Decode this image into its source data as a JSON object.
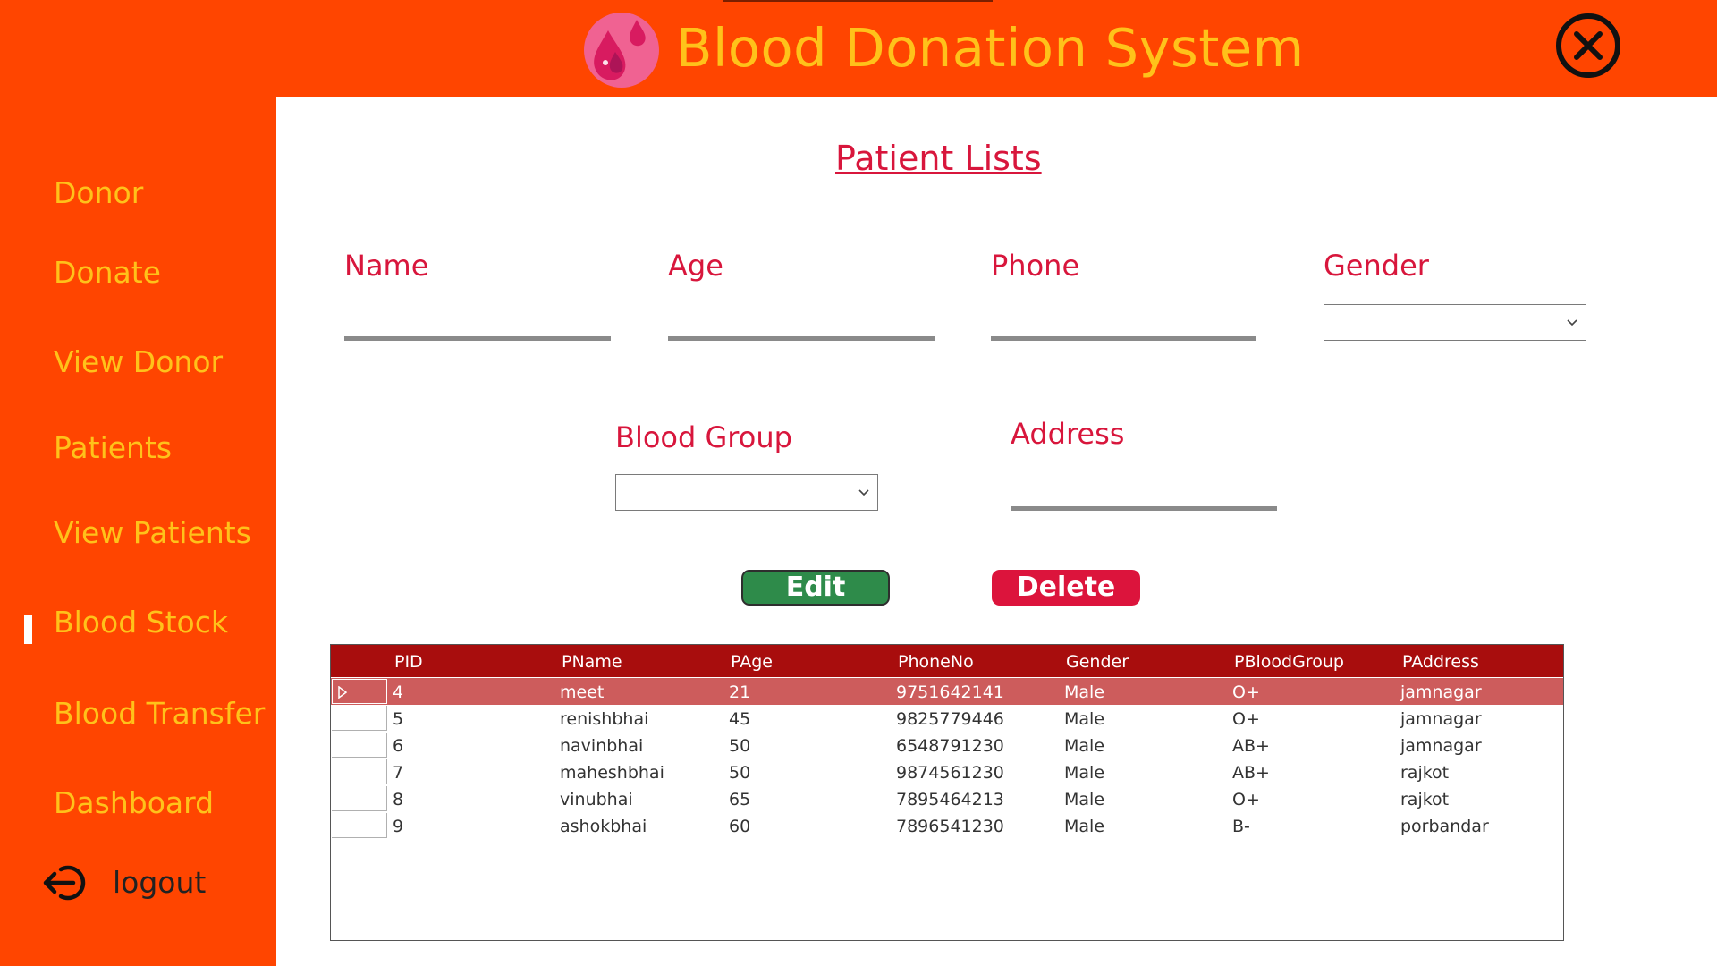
{
  "app": {
    "title": "Blood Donation System",
    "accent_color": "#ff4500",
    "title_color": "#ffc21a",
    "logo_icon": "blood-drop-logo",
    "close_icon": "close-circle-icon"
  },
  "sidebar": {
    "items": [
      {
        "label": "Donor",
        "active": false
      },
      {
        "label": "Donate",
        "active": false
      },
      {
        "label": "View Donor",
        "active": false
      },
      {
        "label": "Patients",
        "active": false
      },
      {
        "label": "View Patients",
        "active": true
      },
      {
        "label": "Blood Stock",
        "active": false
      },
      {
        "label": "Blood Transfer",
        "active": false
      },
      {
        "label": "Dashboard",
        "active": false
      }
    ],
    "logout_label": "logout",
    "logout_icon": "logout-icon"
  },
  "main": {
    "title": "Patient Lists",
    "fields": {
      "name": {
        "label": "Name",
        "value": ""
      },
      "age": {
        "label": "Age",
        "value": ""
      },
      "phone": {
        "label": "Phone",
        "value": ""
      },
      "gender": {
        "label": "Gender",
        "value": ""
      },
      "blood_group": {
        "label": "Blood Group",
        "value": ""
      },
      "address": {
        "label": "Address",
        "value": ""
      }
    },
    "buttons": {
      "edit": "Edit",
      "delete": "Delete",
      "edit_color": "#2e8b4a",
      "delete_color": "#dc143c"
    }
  },
  "grid": {
    "header_color": "#a80d0d",
    "selected_color": "#cd5c5c",
    "columns": [
      "PID",
      "PName",
      "PAge",
      "PhoneNo",
      "Gender",
      "PBloodGroup",
      "PAddress"
    ],
    "rows": [
      [
        "4",
        "meet",
        "21",
        "9751642141",
        "Male",
        "O+",
        "jamnagar"
      ],
      [
        "5",
        "renishbhai",
        "45",
        "9825779446",
        "Male",
        "O+",
        "jamnagar"
      ],
      [
        "6",
        "navinbhai",
        "50",
        "6548791230",
        "Male",
        "AB+",
        "jamnagar"
      ],
      [
        "7",
        "maheshbhai",
        "50",
        "9874561230",
        "Male",
        "AB+",
        "rajkot"
      ],
      [
        "8",
        "vinubhai",
        "65",
        "7895464213",
        "Male",
        "O+",
        "rajkot"
      ],
      [
        "9",
        "ashokbhai",
        "60",
        "7896541230",
        "Male",
        "B-",
        "porbandar"
      ]
    ],
    "selected_row": 0
  }
}
